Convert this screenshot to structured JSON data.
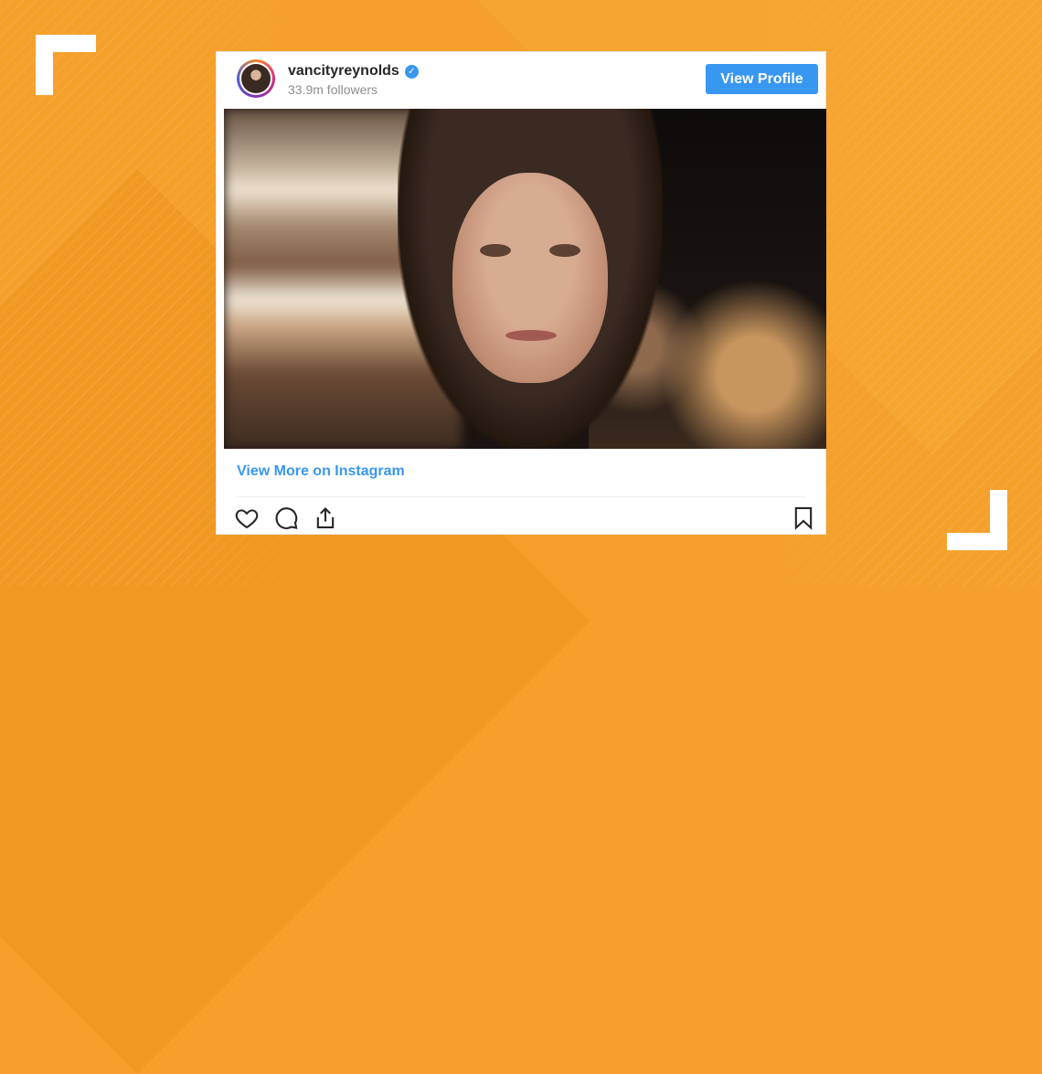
{
  "post": {
    "username": "vancityreynolds",
    "followers": "33.9m followers",
    "view_profile_label": "View Profile",
    "view_more_label": "View More on Instagram"
  },
  "colors": {
    "background": "#f5a02a",
    "accent_blue": "#3897f0",
    "bracket": "#ffffff"
  },
  "icons": {
    "like": "heart-icon",
    "comment": "comment-icon",
    "share": "share-icon",
    "save": "bookmark-icon",
    "verified": "verified-badge-icon"
  }
}
